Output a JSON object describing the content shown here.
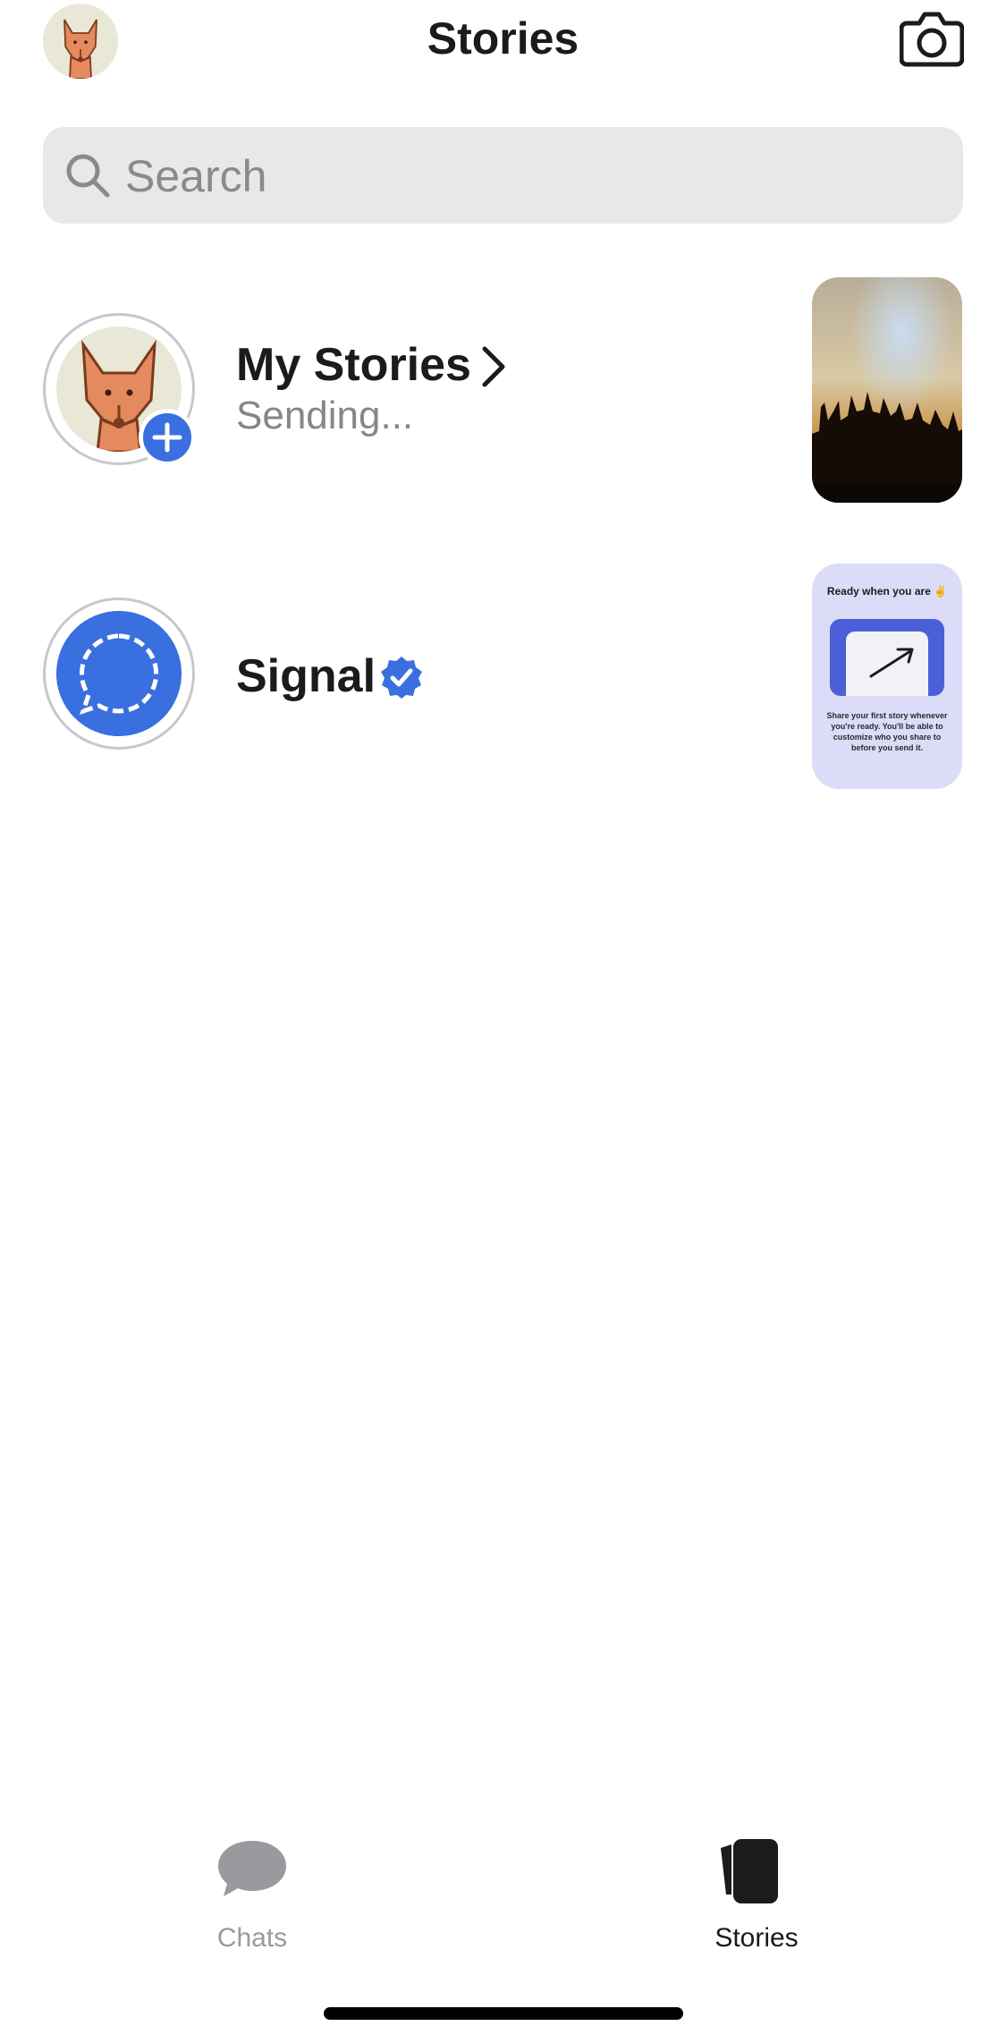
{
  "header": {
    "title": "Stories",
    "avatar_icon": "fox-avatar",
    "camera_icon": "camera-icon"
  },
  "search": {
    "placeholder": "Search",
    "icon": "search-icon"
  },
  "stories": [
    {
      "name": "My Stories",
      "status": "Sending...",
      "avatar_icon": "fox-avatar",
      "badge_icon": "plus-icon",
      "has_chevron": true,
      "thumbnail": "silhouettes-sunset"
    },
    {
      "name": "Signal",
      "verified": true,
      "avatar_icon": "signal-logo",
      "thumbnail": {
        "heading": "Ready when you are ✌️",
        "body": "Share your first story whenever you're ready. You'll be able to customize who you share to before you send it."
      }
    }
  ],
  "tabbar": {
    "tabs": [
      {
        "label": "Chats",
        "icon": "chat-bubble-icon",
        "active": false
      },
      {
        "label": "Stories",
        "icon": "stories-icon",
        "active": true
      }
    ]
  },
  "colors": {
    "accent": "#3a6fe0",
    "active_tab": "#1b1b1d",
    "inactive_tab": "#9a9a9e"
  }
}
